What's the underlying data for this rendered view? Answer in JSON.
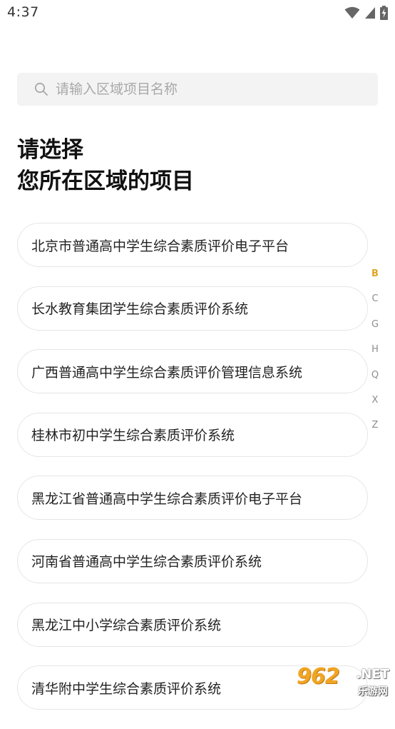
{
  "status_bar": {
    "time": "4:37",
    "icons": [
      "wifi-icon",
      "signal-icon",
      "battery-charging-icon"
    ]
  },
  "search": {
    "placeholder": "请输入区域项目名称",
    "value": ""
  },
  "heading": {
    "line1": "请选择",
    "line2_prefix": "您所在",
    "line2_highlight": "区域的项目",
    "highlight_color": "#f6c243"
  },
  "projects": [
    {
      "label": "北京市普通高中学生综合素质评价电子平台"
    },
    {
      "label": "长水教育集团学生综合素质评价系统"
    },
    {
      "label": "广西普通高中学生综合素质评价管理信息系统"
    },
    {
      "label": "桂林市初中学生综合素质评价系统"
    },
    {
      "label": "黑龙江省普通高中学生综合素质评价电子平台"
    },
    {
      "label": "河南省普通高中学生综合素质评价系统"
    },
    {
      "label": "黑龙江中小学综合素质评价系统"
    },
    {
      "label": "清华附中学生综合素质评价系统"
    }
  ],
  "alpha_index": {
    "letters": [
      "B",
      "C",
      "G",
      "H",
      "Q",
      "X",
      "Z"
    ],
    "active": "B",
    "active_color": "#e0a624"
  },
  "watermark": {
    "main": "962",
    "net": ".NET",
    "sub": "乐游网"
  }
}
